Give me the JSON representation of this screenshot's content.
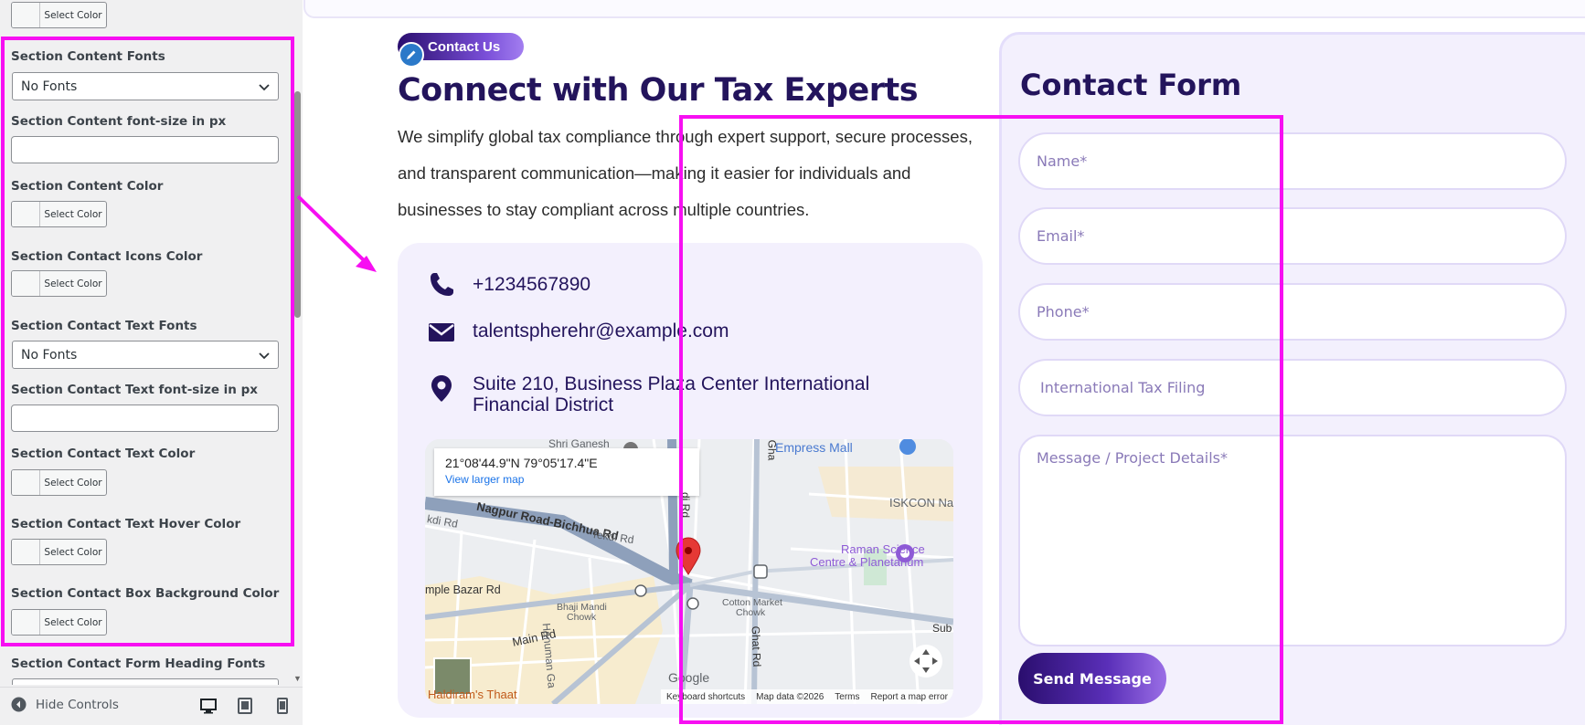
{
  "customizer": {
    "select_color_label": "Select Color",
    "fields": {
      "content_fonts_label": "Section Content Fonts",
      "content_fonts_value": "No Fonts",
      "content_fontsize_label": "Section Content font-size in px",
      "content_color_label": "Section Content Color",
      "contact_icons_color_label": "Section Contact Icons Color",
      "contact_text_fonts_label": "Section Contact Text Fonts",
      "contact_text_fonts_value": "No Fonts",
      "contact_text_fontsize_label": "Section Contact Text font-size in px",
      "contact_text_color_label": "Section Contact Text Color",
      "contact_text_hover_label": "Section Contact Text Hover Color",
      "contact_box_bg_label": "Section Contact Box Background Color",
      "form_heading_fonts_label": "Section Contact Form Heading Fonts"
    },
    "footer": {
      "hide_controls": "Hide Controls",
      "devices": [
        "desktop-icon",
        "tablet-icon",
        "mobile-icon"
      ]
    }
  },
  "preview": {
    "badge": "Contact Us",
    "heading": "Connect with Our Tax Experts",
    "paragraph": "We simplify global tax compliance through expert support, secure processes, and transparent communication—making it easier for individuals and businesses to stay compliant across multiple countries.",
    "contact": {
      "phone": "+1234567890",
      "email": "talentspherehr@example.com",
      "address": "Suite 210, Business Plaza Center International Financial District"
    },
    "map": {
      "coords": "21°08'44.9\"N 79°05'17.4\"E",
      "larger_map": "View larger map",
      "labels": {
        "shri_ganesh": "Shri Ganesh",
        "empress_mall": "Empress Mall",
        "iskcon": "ISKCON Na",
        "nagpur_road": "Nagpur Road-Bichhua Rd",
        "tekdi": "Tekdi Rd",
        "kdi": "kdi Rd",
        "mple_bazar": "mple Bazar Rd",
        "bhaji_mandi": "Bhaji Mandi",
        "chowk": "Chowk",
        "cotton_market": "Cotton Market",
        "cotton_chowk": "Chowk",
        "main_rd": "Main Rd",
        "hanuman": "Hanuman Ga",
        "ghat_rd": "Ghat Rd",
        "raman": "Raman Science",
        "raman2": "Centre & Planetarium",
        "sub": "Sub",
        "haldiram": "Haldiram's Thaat",
        "di_rd": "di Rd",
        "gha": "Gha"
      },
      "footer": {
        "shortcuts": "Keyboard shortcuts",
        "data": "Map data ©2026",
        "terms": "Terms",
        "report": "Report a map error"
      },
      "logo": "Google"
    },
    "form": {
      "title": "Contact Form",
      "name_placeholder": "Name*",
      "email_placeholder": "Email*",
      "phone_placeholder": "Phone*",
      "service_value": "International Tax Filing",
      "message_placeholder": "Message / Project Details*",
      "send_label": "Send Message"
    },
    "colors": {
      "heading": "#23145c",
      "accent": "#5a2fb8",
      "highlight": "#f70ff2",
      "panel_bg": "#f3f0fd"
    }
  }
}
